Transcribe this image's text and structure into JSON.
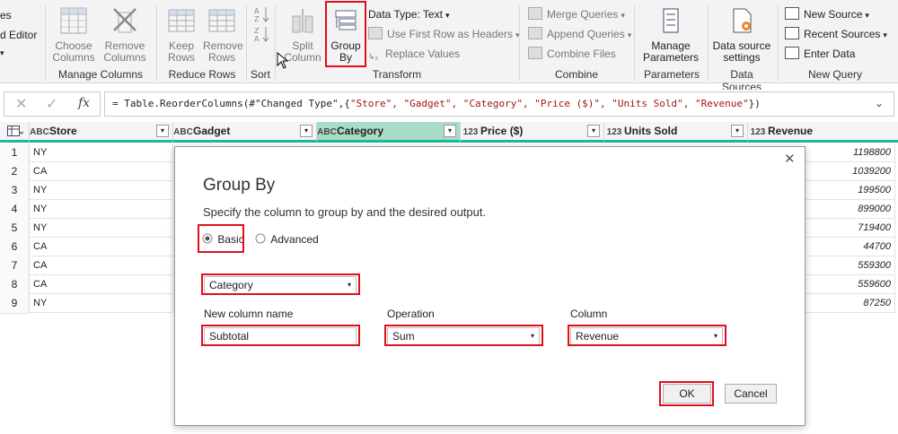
{
  "ribbon": {
    "partial_top": "es",
    "partial_editor": "d Editor",
    "manage_columns": {
      "choose_columns": "Choose\nColumns",
      "remove_columns": "Remove\nColumns",
      "label": "Manage Columns"
    },
    "reduce_rows": {
      "keep_rows": "Keep\nRows",
      "remove_rows": "Remove\nRows",
      "label": "Reduce Rows"
    },
    "sort": {
      "label": "Sort"
    },
    "transform": {
      "split_column": "Split\nColumn",
      "group_by": "Group\nBy",
      "data_type": "Data Type: Text",
      "use_first_row": "Use First Row as Headers",
      "replace_values": "Replace Values",
      "label": "Transform"
    },
    "combine": {
      "merge_queries": "Merge Queries",
      "append_queries": "Append Queries",
      "combine_files": "Combine Files",
      "label": "Combine"
    },
    "parameters": {
      "manage_parameters": "Manage\nParameters",
      "label": "Parameters"
    },
    "data_sources": {
      "settings": "Data source\nsettings",
      "label": "Data Sources"
    },
    "new_query": {
      "new_source": "New Source",
      "recent_sources": "Recent Sources",
      "enter_data": "Enter Data",
      "label": "New Query"
    }
  },
  "formula_bar": {
    "fx": "fx",
    "prefix": "= Table.ReorderColumns(#\"Changed Type\",{",
    "args": "\"Store\", \"Gadget\", \"Category\", \"Price ($)\", \"Units Sold\", \"Revenue\"",
    "suffix": "})"
  },
  "table": {
    "columns": [
      {
        "type": "ABC",
        "name": "Store"
      },
      {
        "type": "ABC",
        "name": "Gadget"
      },
      {
        "type": "ABC",
        "name": "Category"
      },
      {
        "type": "123",
        "name": "Price ($)"
      },
      {
        "type": "123",
        "name": "Units Sold"
      },
      {
        "type": "123",
        "name": "Revenue"
      }
    ],
    "rows": [
      {
        "n": "1",
        "store": "NY",
        "revenue": "1198800"
      },
      {
        "n": "2",
        "store": "CA",
        "revenue": "1039200"
      },
      {
        "n": "3",
        "store": "NY",
        "revenue": "199500"
      },
      {
        "n": "4",
        "store": "NY",
        "revenue": "899000"
      },
      {
        "n": "5",
        "store": "NY",
        "revenue": "719400"
      },
      {
        "n": "6",
        "store": "CA",
        "revenue": "44700"
      },
      {
        "n": "7",
        "store": "CA",
        "revenue": "559300"
      },
      {
        "n": "8",
        "store": "CA",
        "revenue": "559600"
      },
      {
        "n": "9",
        "store": "NY",
        "revenue": "87250"
      }
    ]
  },
  "dialog": {
    "title": "Group By",
    "subtitle": "Specify the column to group by and the desired output.",
    "basic": "Basic",
    "advanced": "Advanced",
    "group_by_value": "Category",
    "new_column_label": "New column name",
    "new_column_value": "Subtotal",
    "operation_label": "Operation",
    "operation_value": "Sum",
    "column_label": "Column",
    "column_value": "Revenue",
    "ok": "OK",
    "cancel": "Cancel",
    "close": "✕"
  },
  "colors": {
    "highlight": "#e0101a",
    "accent": "#1eb89a",
    "selected_header": "#a8dcc6"
  }
}
